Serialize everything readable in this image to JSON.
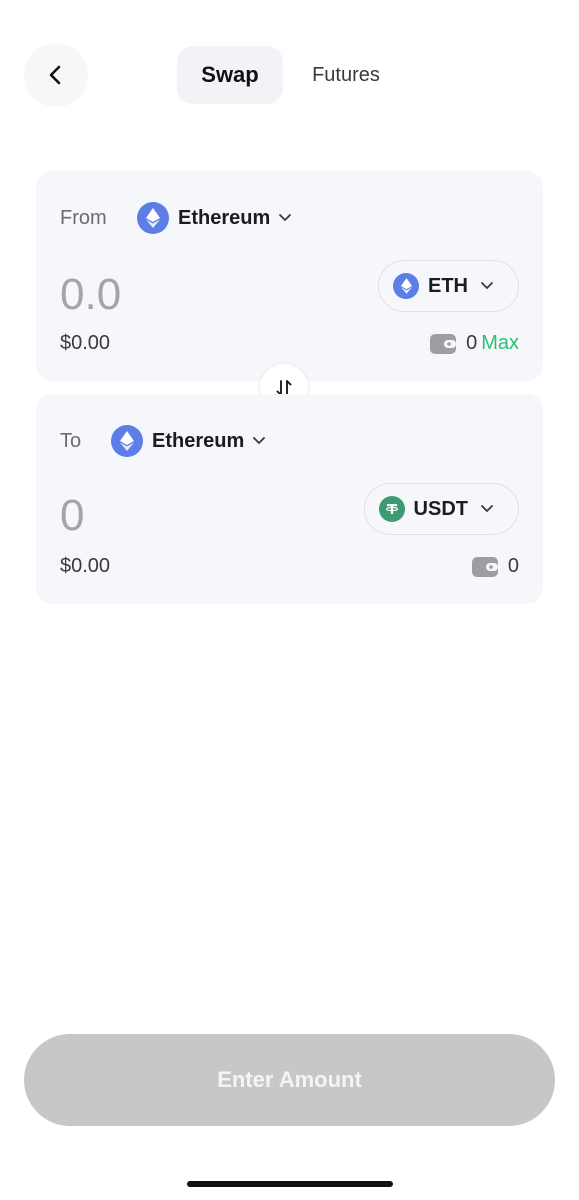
{
  "header": {
    "back_icon": "chevron-left-icon",
    "tabs": [
      {
        "label": "Swap",
        "active": true
      },
      {
        "label": "Futures",
        "active": false
      }
    ]
  },
  "from": {
    "label": "From",
    "chain": "Ethereum",
    "amount_placeholder": "0.0",
    "token": "ETH",
    "usd_value": "$0.00",
    "balance": "0",
    "max_label": "Max"
  },
  "to": {
    "label": "To",
    "chain": "Ethereum",
    "amount_placeholder": "0",
    "token": "USDT",
    "usd_value": "$0.00",
    "balance": "0"
  },
  "cta_label": "Enter Amount",
  "colors": {
    "eth_blue": "#5d7ee6",
    "usdt_green": "#3d9b74",
    "max_green": "#2fbf71",
    "card_bg": "#f6f7fb",
    "cta_disabled": "#c7c7c7"
  }
}
